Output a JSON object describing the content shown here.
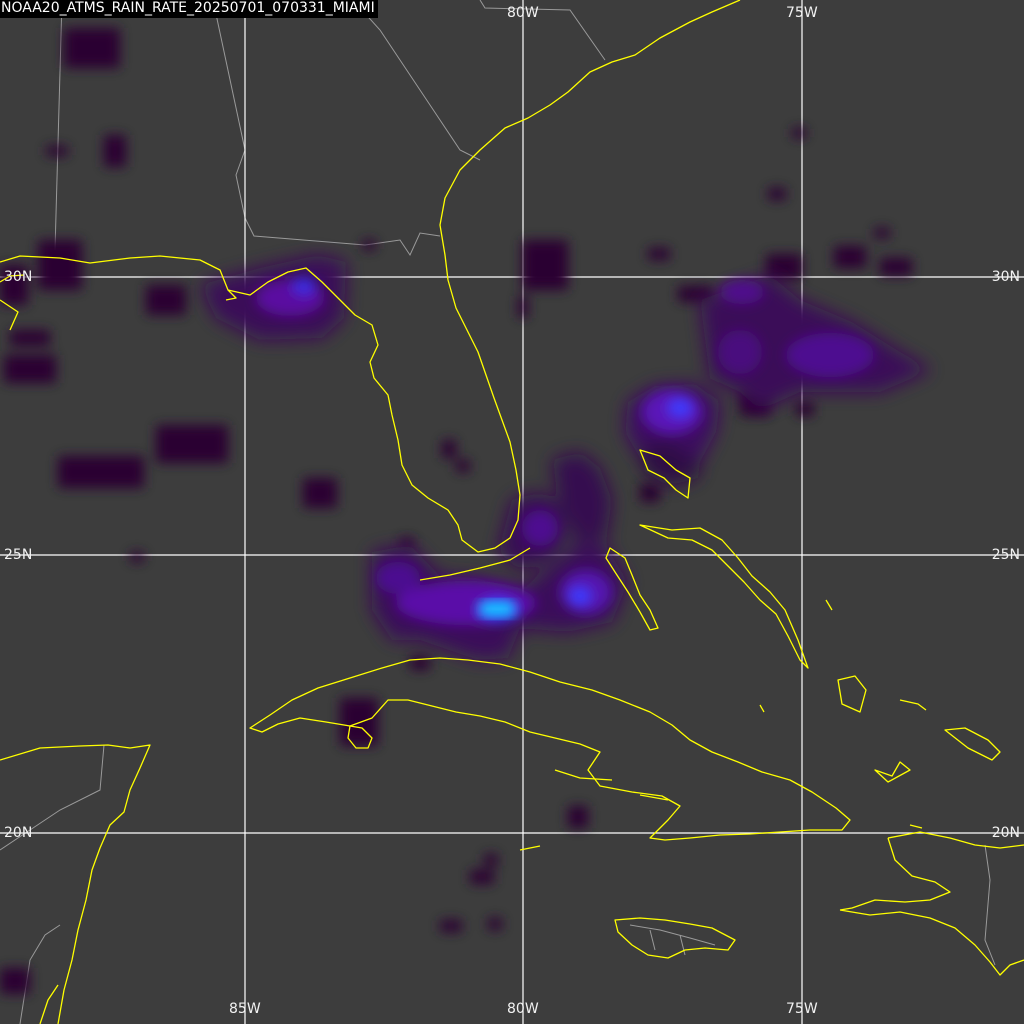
{
  "product_title": "NOAA20_ATMS_RAIN_RATE_20250701_070331_MIAMI",
  "graticule": {
    "lon_top": [
      "80W",
      "75W"
    ],
    "lon_bottom": [
      "85W",
      "80W",
      "75W"
    ],
    "lat_left": [
      "30N",
      "25N",
      "20N"
    ],
    "lat_right": [
      "30N",
      "25N",
      "20N"
    ]
  },
  "colors": {
    "background": "#3d3d3d",
    "coastline": "#ffff00",
    "border": "#9a9a9a",
    "gridline": "#ffffff",
    "rain_light": "#2a0030",
    "rain_moderate": "#5a0ca0",
    "rain_heavy": "#3030ff",
    "rain_extreme": "#19d2ff"
  }
}
